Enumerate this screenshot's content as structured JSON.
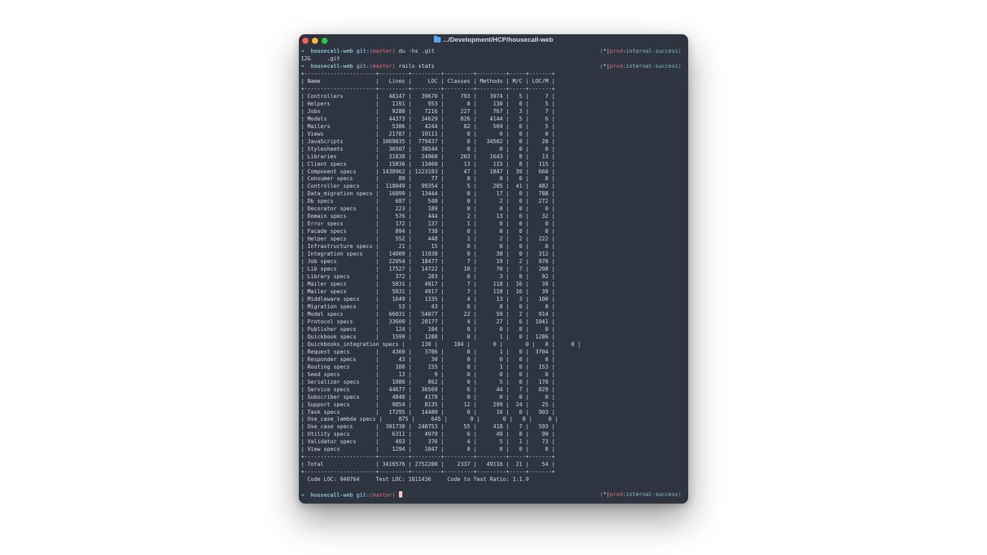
{
  "window": {
    "title": ".../Development/HCP/housecall-web"
  },
  "prompt": {
    "arrow": "➜",
    "repo": "housecall-web",
    "git_label": "git:",
    "branch": "master",
    "right": {
      "star": "*",
      "context": "prod",
      "namespace": "internal-success"
    }
  },
  "commands": [
    "du -hs .git",
    "rails stats"
  ],
  "outputs": {
    "du": "12G\t.git"
  },
  "stats_lines": [
    "+----------------------+---------+---------+---------+---------+-----+-------+",
    "| Name                 |   Lines |     LOC | Classes | Methods | M/C | LOC/M |",
    "+----------------------+---------+---------+---------+---------+-----+-------+",
    "| Controllers          |   48147 |   39670 |     793 |    3974 |   5 |     7 |",
    "| Helpers              |    1191 |     953 |       0 |     130 |   0 |     5 |",
    "| Jobs                 |    9280 |    7216 |     227 |     767 |   3 |     7 |",
    "| Models               |   44373 |   34629 |     826 |    4144 |   5 |     6 |",
    "| Mailers              |    5386 |    4244 |      82 |     569 |   6 |     5 |",
    "| Views                |   21787 |   19111 |       0 |       0 |   0 |     0 |",
    "| JavaScripts          | 1069035 |  779437 |       0 |   34502 |   0 |    20 |",
    "| Stylesheets          |   36507 |   30544 |       0 |       0 |   0 |     0 |",
    "| Libraries            |   31838 |   24960 |     203 |    1643 |   8 |    13 |",
    "| Client specs         |   15836 |   13460 |      13 |     115 |   8 |   115 |",
    "| Component specs      | 1438962 | 1223193 |      47 |    1847 |  39 |   660 |",
    "| Consumer specs       |      89 |      77 |       0 |       0 |   0 |     0 |",
    "| Controller specs     |  118049 |   99354 |       5 |     205 |  41 |   482 |",
    "| Data_migration specs |   16899 |   13444 |       0 |      17 |   0 |   788 |",
    "| Db specs             |     687 |     548 |       0 |       2 |   0 |   272 |",
    "| Decorator specs      |     223 |     189 |       0 |       0 |   0 |     0 |",
    "| Domain specs         |     576 |     444 |       2 |      13 |   6 |    32 |",
    "| Error specs          |     172 |     137 |       1 |       0 |   0 |     0 |",
    "| Facade specs         |     894 |     738 |       0 |       0 |   0 |     0 |",
    "| Helper specs         |     552 |     448 |       1 |       2 |   2 |   222 |",
    "| Infrastructure specs |      21 |      15 |       0 |       0 |   0 |     0 |",
    "| Integration specs    |   14009 |   11938 |       0 |      38 |   0 |   312 |",
    "| Job specs            |   22054 |   18477 |       7 |      19 |   2 |   970 |",
    "| Lib specs            |   17527 |   14722 |      10 |      70 |   7 |   208 |",
    "| Library specs        |     372 |     283 |       0 |       3 |   0 |    92 |",
    "| Mailer specs         |    5831 |    4917 |       7 |     118 |  16 |    39 |",
    "| Mailer specs         |    5831 |    4917 |       7 |     118 |  16 |    39 |",
    "| Middleware specs     |    1649 |    1335 |       4 |      13 |   3 |   100 |",
    "| Migration specs      |      53 |      43 |       0 |       0 |   0 |     0 |",
    "| Model specs          |   66031 |   54077 |      22 |      59 |   2 |   914 |",
    "| Protocol specs       |   33609 |   28177 |       4 |      27 |   6 |  1041 |",
    "| Publisher specs      |     124 |     104 |       0 |       0 |   0 |     0 |",
    "| Quickbook specs      |    1599 |    1288 |       0 |       1 |   0 |  1286 |",
    "| Quickbooks_integration specs |     130 |     104 |       0 |       0 |   0 |     0 |",
    "| Request specs        |    4369 |    3706 |       0 |       1 |   0 |  3704 |",
    "| Responder specs      |      43 |      30 |       0 |       0 |   0 |     0 |",
    "| Routing specs        |     188 |     155 |       0 |       1 |   0 |   153 |",
    "| Seed specs           |      13 |       9 |       0 |       0 |   0 |     0 |",
    "| Serializer specs     |    1086 |     862 |       0 |       5 |   0 |   170 |",
    "| Service specs        |   44677 |   36569 |       6 |      44 |   7 |   829 |",
    "| Subscriber specs     |    4848 |    4178 |       0 |       0 |   0 |     0 |",
    "| Support specs        |    9854 |    8135 |      12 |     299 |  24 |    25 |",
    "| Task specs           |   17295 |   14480 |       0 |      16 |   0 |   903 |",
    "| Use_case_lambda specs |     875 |     645 |       0 |       0 |   0 |     0 |",
    "| Use_case specs       |  301738 |  248753 |      55 |     418 |   7 |   593 |",
    "| Utility specs        |    6311 |    4979 |       6 |      49 |   8 |    99 |",
    "| Validator specs      |     493 |     376 |       4 |       5 |   1 |    73 |",
    "| View specs           |    1294 |    1047 |       0 |       0 |   0 |     0 |",
    "+----------------------+---------+---------+---------+---------+-----+-------+",
    "| Total                | 3416576 | 2752200 |    2337 |   49116 |  21 |    54 |",
    "+----------------------+---------+---------+---------+---------+-----+-------+",
    "  Code LOC: 940764     Test LOC: 1811436     Code to Test Ratio: 1:1.9",
    ""
  ]
}
